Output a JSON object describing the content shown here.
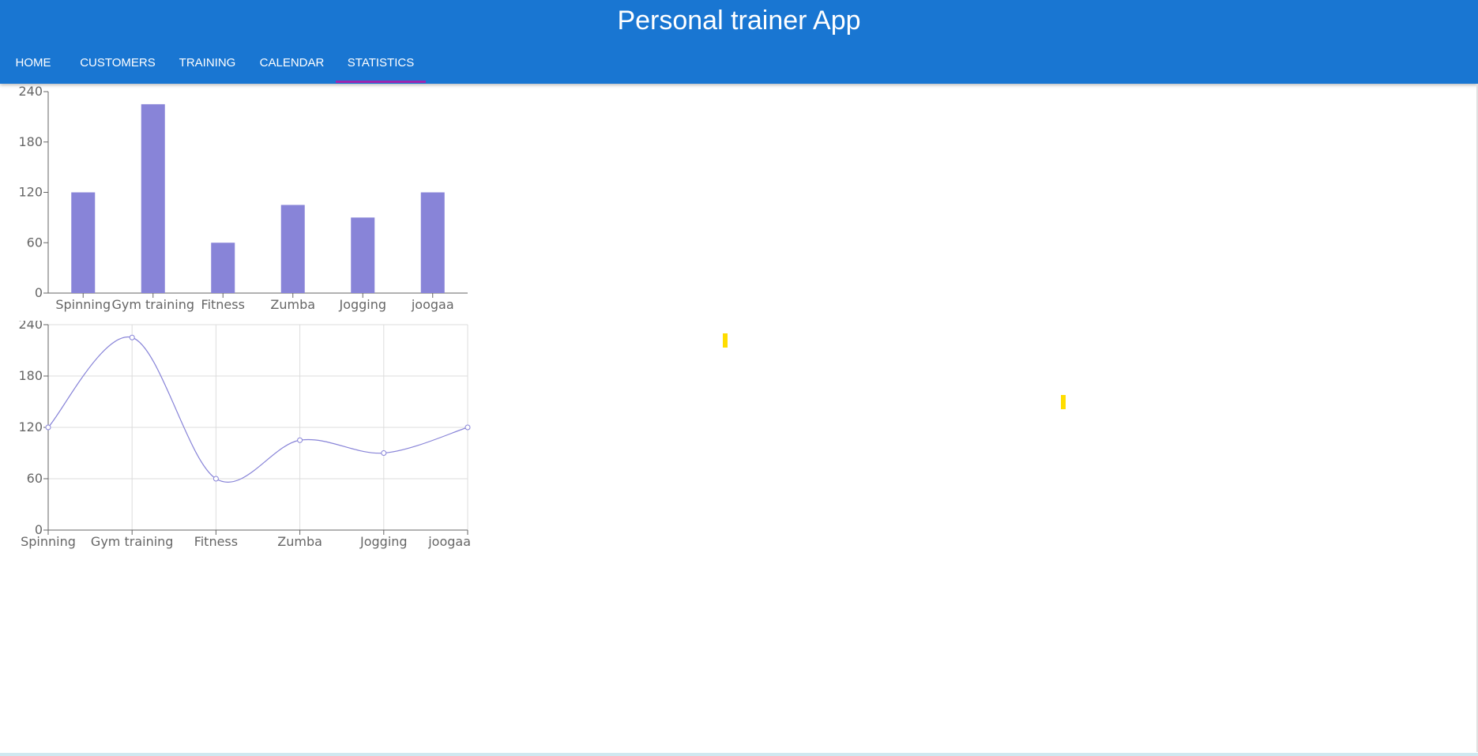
{
  "app": {
    "title": "Personal trainer App"
  },
  "tabs": [
    {
      "label": "HOME"
    },
    {
      "label": "CUSTOMERS"
    },
    {
      "label": "TRAINING"
    },
    {
      "label": "CALENDAR"
    },
    {
      "label": "STATISTICS",
      "active": true
    }
  ],
  "colors": {
    "appbar": "#1976d2",
    "indicator": "#9c27b0",
    "series": "#8884d8",
    "marker": "#ffdd00"
  },
  "chart_data": [
    {
      "type": "bar",
      "categories": [
        "Spinning",
        "Gym training",
        "Fitness",
        "Zumba",
        "Jogging",
        "joogaa"
      ],
      "values": [
        120,
        225,
        60,
        105,
        90,
        120
      ],
      "yticks": [
        0,
        60,
        120,
        180,
        240
      ],
      "ylim": [
        0,
        240
      ],
      "grid": false
    },
    {
      "type": "line",
      "categories": [
        "Spinning",
        "Gym training",
        "Fitness",
        "Zumba",
        "Jogging",
        "joogaa"
      ],
      "values": [
        120,
        225,
        60,
        105,
        90,
        120
      ],
      "yticks": [
        0,
        60,
        120,
        180,
        240
      ],
      "ylim": [
        0,
        240
      ],
      "grid": true
    }
  ]
}
